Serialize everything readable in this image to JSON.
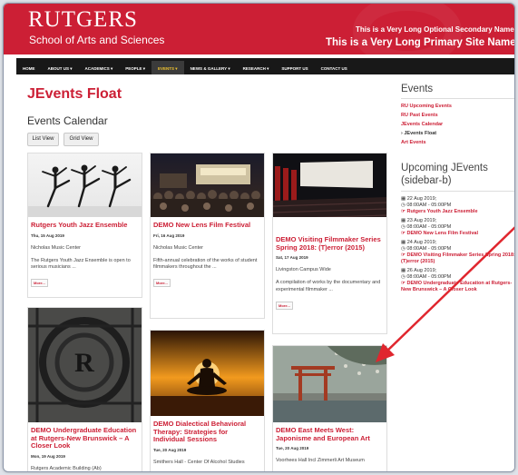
{
  "header": {
    "logo_word": "RUTGERS",
    "logo_sub": "School of Arts and Sciences",
    "secondary_name": "This is a Very Long Optional Secondary Name",
    "primary_name": "This is a Very Long Primary Site Name",
    "bg_color": "#cc1f35"
  },
  "nav": {
    "items": [
      "HOME",
      "ABOUT US ▾",
      "ACADEMICS ▾",
      "PEOPLE ▾",
      "EVENTS ▾",
      "NEWS & GALLERY ▾",
      "RESEARCH ▾",
      "SUPPORT US",
      "CONTACT US"
    ],
    "active_index": 4
  },
  "main": {
    "page_title": "JEvents Float",
    "calendar_title": "Events Calendar",
    "list_view_label": "List View",
    "grid_view_label": "Grid View",
    "more_label": "More...",
    "cards": [
      {
        "title": "Rutgers Youth Jazz Ensemble",
        "date": "Thu, 15 Aug 2019",
        "location": "Nicholas Music Center",
        "desc": "The Rutgers Youth Jazz Ensemble is open to serious musicians ...",
        "image": "dancers-photo"
      },
      {
        "title": "DEMO New Lens Film Festival",
        "date": "Fri, 16 Aug 2019",
        "location": "Nicholas Music Center",
        "desc": "Fifth-annual celebration of the works of student filmmakers throughout the ...",
        "image": "crowd-photo"
      },
      {
        "title": "DEMO Visiting Filmmaker Series Spring 2018: (T)error (2015)",
        "date": "Sat, 17 Aug 2019",
        "location": "Livingston Campus Wide",
        "desc": "A compilation of works by the documentary and experimental filmmaker ...",
        "image": "cinema-photo"
      },
      {
        "title": "DEMO Undergraduate Education at Rutgers-New Brunswick – A Closer Look",
        "date": "Mon, 19 Aug 2019",
        "location": "Rutgers Academic Building (Ab)",
        "image": "gate-photo"
      },
      {
        "title": "DEMO Dialectical Behavioral Therapy: Strategies for Individual Sessions",
        "date": "Tue, 20 Aug 2019",
        "location": "Smithers Hall - Center Of Alcohol Studies",
        "image": "meditation-photo"
      },
      {
        "title": "DEMO East Meets West: Japonisme and European Art",
        "date": "Tue, 20 Aug 2019",
        "location": "Voorhees Hall Incl Zimmerli Art Museum",
        "image": "torii-painting"
      }
    ]
  },
  "sidebar": {
    "events_heading": "Events",
    "events_links": [
      "RU Upcoming Events",
      "RU Past Events",
      "JEvents Calendar",
      "JEvents Float",
      "Art Events"
    ],
    "current_link_index": 3,
    "upcoming_heading": "Upcoming JEvents (sidebar-b)",
    "upcoming": [
      {
        "date": "22 Aug 2019;",
        "time": "08:00AM - 05:00PM",
        "title": "Rutgers Youth Jazz Ensemble"
      },
      {
        "date": "23 Aug 2019;",
        "time": "08:00AM - 05:00PM",
        "title": "DEMO New Lens Film Festival"
      },
      {
        "date": "24 Aug 2019;",
        "time": "08:00AM - 05:00PM",
        "title": "DEMO Visiting Filmmaker Series Spring 2018: (T)error (2015)"
      },
      {
        "date": "26 Aug 2019;",
        "time": "08:00AM - 05:00PM",
        "title": "DEMO Undergraduate Education at Rutgers-New Brunswick – A Closer Look"
      }
    ]
  },
  "annotation": {
    "arrow_color": "#e0262e"
  }
}
